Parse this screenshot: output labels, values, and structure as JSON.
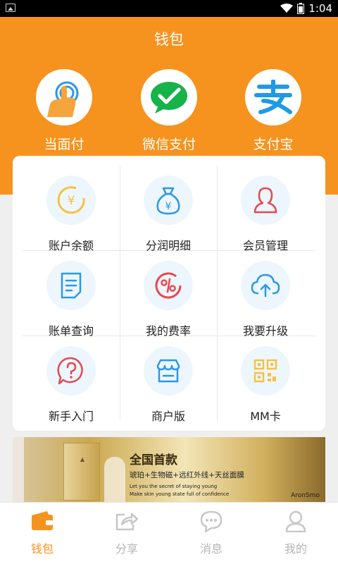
{
  "status_bar": {
    "time": "1:04"
  },
  "header": {
    "title": "钱包"
  },
  "quick_actions": [
    {
      "label": "当面付",
      "icon": "tap-hand-icon"
    },
    {
      "label": "微信支付",
      "icon": "wechat-pay-icon"
    },
    {
      "label": "支付宝",
      "icon": "alipay-icon"
    }
  ],
  "grid": [
    {
      "label": "账户余额",
      "icon": "yuan-coin-icon"
    },
    {
      "label": "分润明细",
      "icon": "money-bag-icon"
    },
    {
      "label": "会员管理",
      "icon": "member-icon"
    },
    {
      "label": "账单查询",
      "icon": "bill-icon"
    },
    {
      "label": "我的费率",
      "icon": "percent-icon"
    },
    {
      "label": "我要升级",
      "icon": "cloud-upload-icon"
    },
    {
      "label": "新手入门",
      "icon": "help-icon"
    },
    {
      "label": "商户版",
      "icon": "shop-icon"
    },
    {
      "label": "MM卡",
      "icon": "qr-code-icon"
    }
  ],
  "banner": {
    "headline": "全国首款",
    "subline": "琥珀+生物磁+远红外线+天丝面膜",
    "english_1": "Let you the secret of staying young",
    "english_2": "Make skin young state full of confidence",
    "brand": "AronSmo"
  },
  "tabs": [
    {
      "label": "钱包",
      "icon": "wallet-icon",
      "active": true
    },
    {
      "label": "分享",
      "icon": "share-icon",
      "active": false
    },
    {
      "label": "消息",
      "icon": "message-icon",
      "active": false
    },
    {
      "label": "我的",
      "icon": "profile-icon",
      "active": false
    }
  ],
  "colors": {
    "accent": "#f5931e",
    "icon_bg": "#eef6fd",
    "icon_yellow": "#f6c244",
    "icon_blue": "#2a98e8",
    "icon_red": "#e8484f",
    "tab_inactive": "#b5b5b5"
  }
}
